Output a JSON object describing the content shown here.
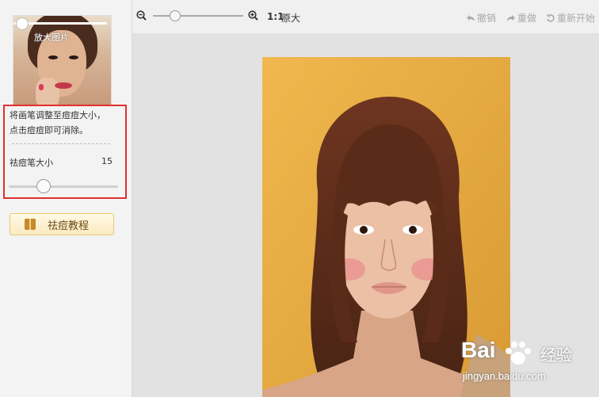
{
  "sidebar": {
    "thumbnail_label": "放大图片",
    "hint_line1": "将画笔调整至痘痘大小，",
    "hint_line2": "点击痘痘即可消除。",
    "brush_size_label": "祛痘笔大小",
    "brush_size_value": "15",
    "brush_size_fraction": 0.3,
    "tutorial_button": "祛痘教程"
  },
  "toolbar": {
    "zoom_ratio": "1:1",
    "original_size": "原大",
    "undo": "撤销",
    "redo": "重做",
    "restart": "重新开始",
    "zoom_level_fraction": 0.25
  },
  "watermark": {
    "brand": "Bai",
    "brand_cn": "经验",
    "url": "jingyan.baidu.com"
  },
  "colors": {
    "highlight_border": "#e03030",
    "photo_background": "#e8ae45"
  }
}
